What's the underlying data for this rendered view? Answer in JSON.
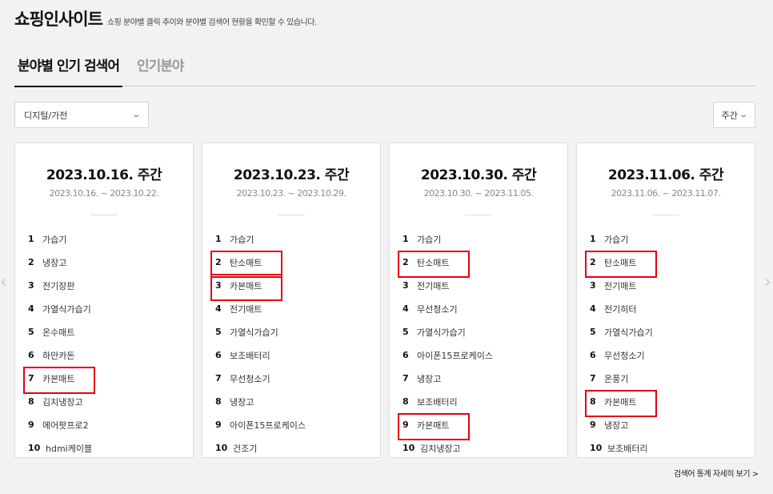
{
  "header": {
    "title": "쇼핑인사이트",
    "description": "쇼핑 분야별 클릭 추이와 분야별 검색어 현황을 확인할 수 있습니다."
  },
  "tabs": [
    {
      "label": "분야별 인기 검색어",
      "active": true
    },
    {
      "label": "인기분야",
      "active": false
    }
  ],
  "category_select": {
    "value": "디지털/가전"
  },
  "period_select": {
    "value": "주간"
  },
  "cards": [
    {
      "week": "2023.10.16. 주간",
      "range": "2023.10.16. ~ 2023.10.22.",
      "items": [
        {
          "rank": "1",
          "keyword": "가습기"
        },
        {
          "rank": "2",
          "keyword": "냉장고"
        },
        {
          "rank": "3",
          "keyword": "전기장판"
        },
        {
          "rank": "4",
          "keyword": "가열식가습기"
        },
        {
          "rank": "5",
          "keyword": "온수매트"
        },
        {
          "rank": "6",
          "keyword": "하만카돈"
        },
        {
          "rank": "7",
          "keyword": "카본매트"
        },
        {
          "rank": "8",
          "keyword": "김치냉장고"
        },
        {
          "rank": "9",
          "keyword": "에어팟프로2"
        },
        {
          "rank": "10",
          "keyword": "hdmi케이블"
        }
      ]
    },
    {
      "week": "2023.10.23. 주간",
      "range": "2023.10.23. ~ 2023.10.29.",
      "items": [
        {
          "rank": "1",
          "keyword": "가습기"
        },
        {
          "rank": "2",
          "keyword": "탄소매트"
        },
        {
          "rank": "3",
          "keyword": "카본매트"
        },
        {
          "rank": "4",
          "keyword": "전기매트"
        },
        {
          "rank": "5",
          "keyword": "가열식가습기"
        },
        {
          "rank": "6",
          "keyword": "보조배터리"
        },
        {
          "rank": "7",
          "keyword": "무선청소기"
        },
        {
          "rank": "8",
          "keyword": "냉장고"
        },
        {
          "rank": "9",
          "keyword": "아이폰15프로케이스"
        },
        {
          "rank": "10",
          "keyword": "건조기"
        }
      ]
    },
    {
      "week": "2023.10.30. 주간",
      "range": "2023.10.30. ~ 2023.11.05.",
      "items": [
        {
          "rank": "1",
          "keyword": "가습기"
        },
        {
          "rank": "2",
          "keyword": "탄소매트"
        },
        {
          "rank": "3",
          "keyword": "전기매트"
        },
        {
          "rank": "4",
          "keyword": "무선청소기"
        },
        {
          "rank": "5",
          "keyword": "가열식가습기"
        },
        {
          "rank": "6",
          "keyword": "아이폰15프로케이스"
        },
        {
          "rank": "7",
          "keyword": "냉장고"
        },
        {
          "rank": "8",
          "keyword": "보조배터리"
        },
        {
          "rank": "9",
          "keyword": "카본매트"
        },
        {
          "rank": "10",
          "keyword": "김치냉장고"
        }
      ]
    },
    {
      "week": "2023.11.06. 주간",
      "range": "2023.11.06. ~ 2023.11.07.",
      "items": [
        {
          "rank": "1",
          "keyword": "가습기"
        },
        {
          "rank": "2",
          "keyword": "탄소매트"
        },
        {
          "rank": "3",
          "keyword": "전기매트"
        },
        {
          "rank": "4",
          "keyword": "전기히터"
        },
        {
          "rank": "5",
          "keyword": "가열식가습기"
        },
        {
          "rank": "6",
          "keyword": "무선청소기"
        },
        {
          "rank": "7",
          "keyword": "온풍기"
        },
        {
          "rank": "8",
          "keyword": "카본매트"
        },
        {
          "rank": "9",
          "keyword": "냉장고"
        },
        {
          "rank": "10",
          "keyword": "보조배터리"
        }
      ]
    }
  ],
  "more_link": {
    "label": "검색어 통계 자세히 보기 >"
  },
  "icons": {
    "chevron_down": "chevron-down-icon",
    "nav_left": "chevron-left-icon",
    "nav_right": "chevron-right-icon"
  },
  "colors": {
    "highlight": "#e60012",
    "background": "#f2f2f2",
    "card": "#ffffff"
  }
}
